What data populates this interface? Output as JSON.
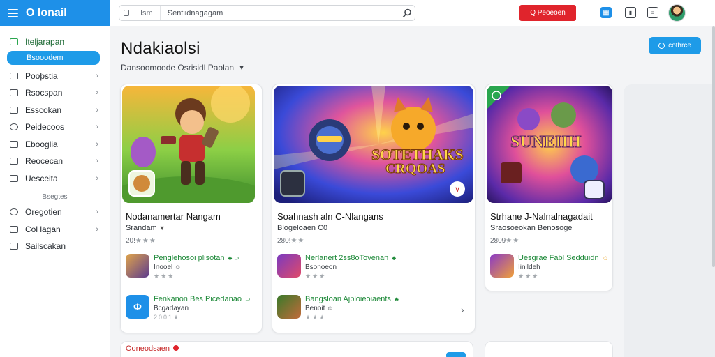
{
  "sidebar": {
    "brand": "O lonail",
    "items_top": [
      {
        "label": "Iteljarapan",
        "icon": "store-icon"
      },
      {
        "label": "Bsooodem",
        "icon": "home-icon",
        "active": true
      }
    ],
    "items_main": [
      {
        "label": "Pooþstia",
        "icon": "document-icon"
      },
      {
        "label": "Rsocspan",
        "icon": "calendar-icon"
      },
      {
        "label": "Esscokan",
        "icon": "list-icon"
      },
      {
        "label": "Peidecoos",
        "icon": "globe-icon"
      },
      {
        "label": "Ebooglia",
        "icon": "book-icon"
      },
      {
        "label": "Reocecan",
        "icon": "grid-icon"
      },
      {
        "label": "Uesceita",
        "icon": "table-icon"
      }
    ],
    "section_heading": "Bsegtes",
    "items_bottom": [
      {
        "label": "Oregotien",
        "icon": "globe-icon"
      },
      {
        "label": "Col lagan",
        "icon": "chat-icon"
      },
      {
        "label": "Sailscakan",
        "icon": "square-icon"
      }
    ]
  },
  "topbar": {
    "search_scope": "Ism",
    "search_query": "Sentiidnagagam",
    "cta_label": "Q Peoeoen",
    "icons": [
      "apps-icon",
      "bookmark-icon",
      "notes-icon"
    ]
  },
  "main": {
    "title": "Ndakiaolsi",
    "filter_text": "Dansoomoode Osrisidl Paolan",
    "top_button_label": "cothrce",
    "cards": [
      {
        "title": "Nodanamertar Nangam",
        "subtitle": "Srandam",
        "rating_prefix": "20!",
        "stars": "★★★",
        "recs": [
          {
            "title": "Penglehosoi plisotan",
            "mark": "♣ ⊃",
            "sub": "Inooel",
            "sub_mark": "☺",
            "stars": "★★★"
          },
          {
            "title": "Fenkanon Bes Picedanao",
            "mark": "⊃",
            "sub": "Bcgadayan",
            "sub_mark": "",
            "stars": "2001★"
          }
        ]
      },
      {
        "title": "Soahnash aln C-Nlangans",
        "subtitle": "Blogeloaen C0",
        "rating_prefix": "280!",
        "stars": "★★",
        "hero_text_1": "SOTETHAKS",
        "hero_text_2": "CRQOAS",
        "recs": [
          {
            "title": "Nerlanert 2ss8oTovenan",
            "mark": "♣",
            "sub": "Bsonoeon",
            "sub_mark": "",
            "stars": "★★★"
          },
          {
            "title": "Bangsloan Ajploieoiaents",
            "mark": "♣",
            "sub": "Benoit",
            "sub_mark": "☺",
            "stars": "★★★"
          }
        ]
      },
      {
        "title": "Strhane J-Nalnalnagadait",
        "subtitle": "Sraosoeokan Benosoge",
        "rating_prefix": "2809",
        "stars": "★★",
        "hero_text_1": "SUNEIIH",
        "recs": [
          {
            "title": "Uesgrae Fabl Sedduidn",
            "mark": "☺",
            "sub": "Iinildeh",
            "sub_mark": "",
            "stars": "★★★"
          }
        ]
      }
    ],
    "bottom_label": "Ooneodsaen",
    "bottom_dash": "— — — —"
  },
  "colors": {
    "brand_blue": "#1e90e8",
    "cta_red": "#e0242c",
    "rec_green": "#1f8a3a"
  }
}
